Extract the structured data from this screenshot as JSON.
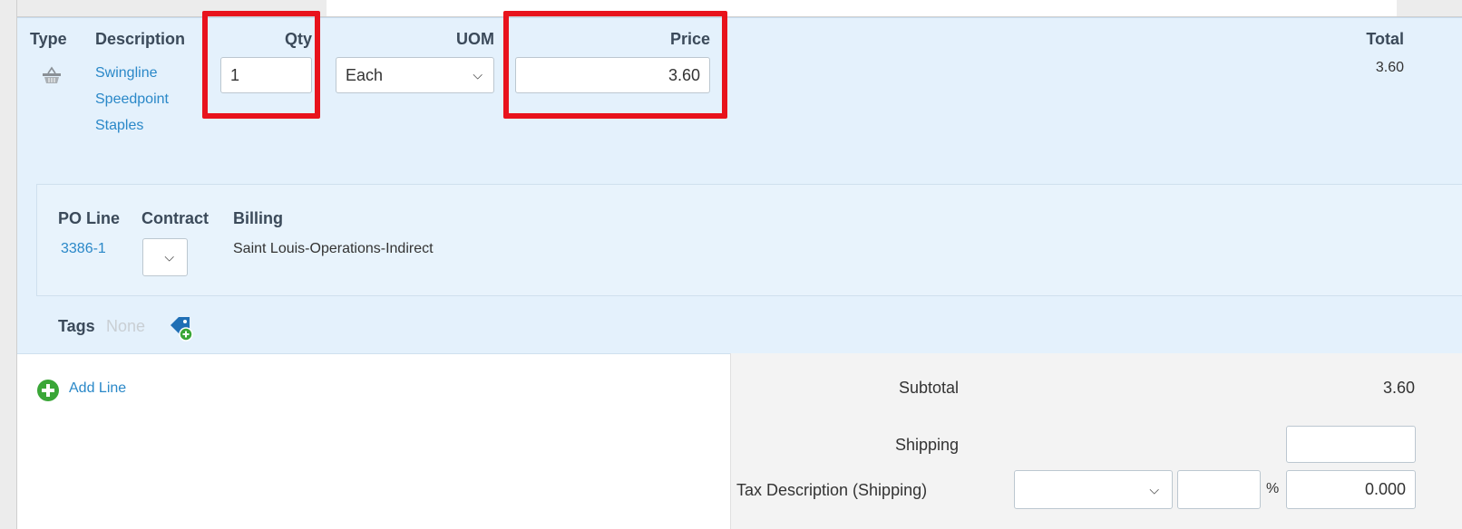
{
  "line_item": {
    "headers": {
      "type": "Type",
      "description": "Description",
      "qty": "Qty",
      "uom": "UOM",
      "price": "Price",
      "total": "Total"
    },
    "type_icon": "basket-icon",
    "description_lines": [
      "Swingline",
      "Speedpoint",
      "Staples"
    ],
    "qty_value": "1",
    "uom_value": "Each",
    "price_value": "3.60",
    "total_value": "3.60"
  },
  "sub_details": {
    "headers": {
      "po_line": "PO Line",
      "contract": "Contract",
      "billing": "Billing"
    },
    "po_line_value": "3386-1",
    "contract_value": "",
    "billing_value": "Saint Louis-Operations-Indirect"
  },
  "tags": {
    "label": "Tags",
    "value": "None",
    "icon": "add-tag-icon"
  },
  "actions": {
    "add_line_label": "Add Line",
    "add_icon": "plus-circle-icon"
  },
  "totals": {
    "subtotal_label": "Subtotal",
    "subtotal_value": "3.60",
    "shipping_label": "Shipping",
    "shipping_value": "",
    "tax_shipping_label": "Tax Description (Shipping)",
    "tax_select_value": "",
    "tax_percent_value": "",
    "percent_symbol": "%",
    "tax_amount_value": "0.000"
  },
  "colors": {
    "highlight": "#e8131c",
    "link": "#2a88c8",
    "panel_bg": "#e4f1fc",
    "add_green": "#3aa637"
  }
}
